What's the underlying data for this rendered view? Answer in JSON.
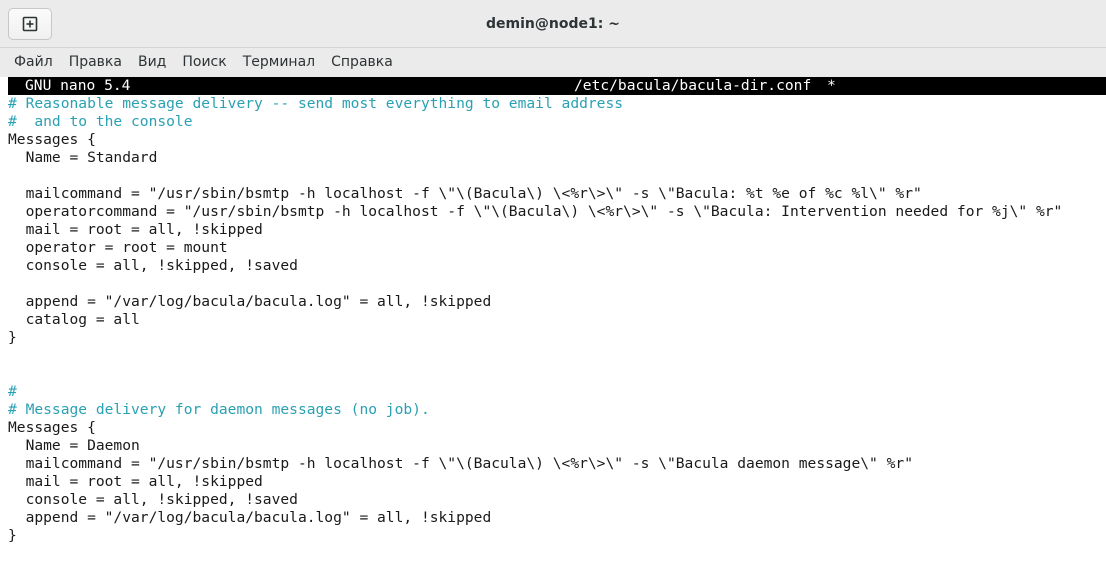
{
  "window": {
    "title": "demin@node1: ~"
  },
  "menu": {
    "items": [
      "Файл",
      "Правка",
      "Вид",
      "Поиск",
      "Терминал",
      "Справка"
    ]
  },
  "nano": {
    "version": "GNU nano 5.4",
    "filename": "/etc/bacula/bacula-dir.conf",
    "modified_marker": "*"
  },
  "editor": {
    "lines": [
      {
        "text": "# Reasonable message delivery -- send most everything to email address",
        "comment": true
      },
      {
        "text": "#  and to the console",
        "comment": true
      },
      {
        "text": "Messages {",
        "comment": false
      },
      {
        "text": "  Name = Standard",
        "comment": false
      },
      {
        "text": "",
        "comment": false
      },
      {
        "text": "  mailcommand = \"/usr/sbin/bsmtp -h localhost -f \\\"\\(Bacula\\) \\<%r\\>\\\" -s \\\"Bacula: %t %e of %c %l\\\" %r\"",
        "comment": false
      },
      {
        "text": "  operatorcommand = \"/usr/sbin/bsmtp -h localhost -f \\\"\\(Bacula\\) \\<%r\\>\\\" -s \\\"Bacula: Intervention needed for %j\\\" %r\"",
        "comment": false
      },
      {
        "text": "  mail = root = all, !skipped",
        "comment": false
      },
      {
        "text": "  operator = root = mount",
        "comment": false
      },
      {
        "text": "  console = all, !skipped, !saved",
        "comment": false
      },
      {
        "text": "",
        "comment": false
      },
      {
        "text": "  append = \"/var/log/bacula/bacula.log\" = all, !skipped",
        "comment": false
      },
      {
        "text": "  catalog = all",
        "comment": false
      },
      {
        "text": "}",
        "comment": false
      },
      {
        "text": "",
        "comment": false
      },
      {
        "text": "",
        "comment": false
      },
      {
        "text": "#",
        "comment": true
      },
      {
        "text": "# Message delivery for daemon messages (no job).",
        "comment": true
      },
      {
        "text": "Messages {",
        "comment": false
      },
      {
        "text": "  Name = Daemon",
        "comment": false
      },
      {
        "text": "  mailcommand = \"/usr/sbin/bsmtp -h localhost -f \\\"\\(Bacula\\) \\<%r\\>\\\" -s \\\"Bacula daemon message\\\" %r\"",
        "comment": false
      },
      {
        "text": "  mail = root = all, !skipped",
        "comment": false
      },
      {
        "text": "  console = all, !skipped, !saved",
        "comment": false
      },
      {
        "text": "  append = \"/var/log/bacula/bacula.log\" = all, !skipped",
        "comment": false
      },
      {
        "text": "}",
        "comment": false
      }
    ]
  },
  "colors": {
    "comment": "#2aa1b3",
    "text": "#1a1a1a",
    "header_bg": "#000000",
    "header_fg": "#ffffff"
  }
}
